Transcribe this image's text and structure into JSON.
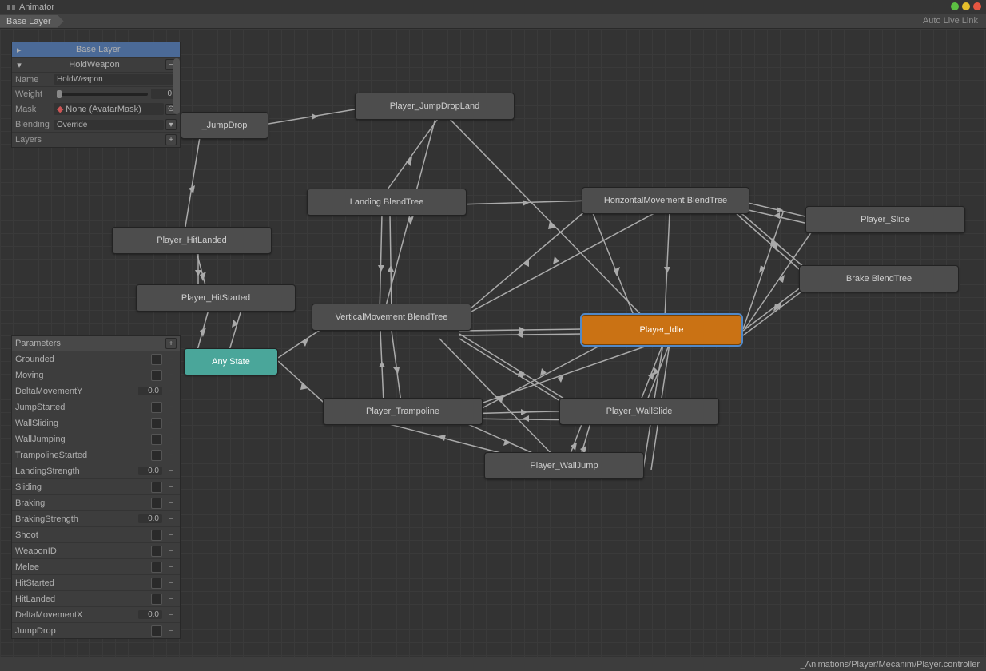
{
  "window": {
    "title": "Animator"
  },
  "toolbar": {
    "breadcrumb": "Base Layer",
    "auto_live_link": "Auto Live Link"
  },
  "footer": {
    "path": "_Animations/Player/Mecanim/Player.controller"
  },
  "layers": {
    "active": "Base Layer",
    "title": "HoldWeapon",
    "rows": {
      "name": {
        "label": "Name",
        "value": "HoldWeapon"
      },
      "weight": {
        "label": "Weight",
        "value": "0"
      },
      "mask": {
        "label": "Mask",
        "value": "None (AvatarMask)"
      },
      "blending": {
        "label": "Blending",
        "value": "Override"
      },
      "layers": {
        "label": "Layers",
        "add": "+"
      }
    }
  },
  "parameters": {
    "title": "Parameters",
    "items": [
      {
        "name": "Grounded",
        "type": "bool"
      },
      {
        "name": "Moving",
        "type": "bool"
      },
      {
        "name": "DeltaMovementY",
        "type": "float",
        "value": "0.0"
      },
      {
        "name": "JumpStarted",
        "type": "bool"
      },
      {
        "name": "WallSliding",
        "type": "bool"
      },
      {
        "name": "WallJumping",
        "type": "bool"
      },
      {
        "name": "TrampolineStarted",
        "type": "bool"
      },
      {
        "name": "LandingStrength",
        "type": "float",
        "value": "0.0"
      },
      {
        "name": "Sliding",
        "type": "bool"
      },
      {
        "name": "Braking",
        "type": "bool"
      },
      {
        "name": "BrakingStrength",
        "type": "float",
        "value": "0.0"
      },
      {
        "name": "Shoot",
        "type": "bool"
      },
      {
        "name": "WeaponID",
        "type": "bool"
      },
      {
        "name": "Melee",
        "type": "bool"
      },
      {
        "name": "HitStarted",
        "type": "bool"
      },
      {
        "name": "HitLanded",
        "type": "bool"
      },
      {
        "name": "DeltaMovementX",
        "type": "float",
        "value": "0.0"
      },
      {
        "name": "JumpDrop",
        "type": "bool"
      }
    ]
  },
  "nodes": {
    "jumpdrop": {
      "label": "_JumpDrop"
    },
    "jumpdropland": {
      "label": "Player_JumpDropLand"
    },
    "landingbt": {
      "label": "Landing BlendTree"
    },
    "hmovebt": {
      "label": "HorizontalMovement BlendTree"
    },
    "slide": {
      "label": "Player_Slide"
    },
    "hitlanded": {
      "label": "Player_HitLanded"
    },
    "hitstarted": {
      "label": "Player_HitStarted"
    },
    "brakebt": {
      "label": "Brake BlendTree"
    },
    "vmovebt": {
      "label": "VerticalMovement BlendTree"
    },
    "idle": {
      "label": "Player_Idle"
    },
    "anystate": {
      "label": "Any State"
    },
    "trampoline": {
      "label": "Player_Trampoline"
    },
    "wallslide": {
      "label": "Player_WallSlide"
    },
    "walljump": {
      "label": "Player_WallJump"
    }
  }
}
